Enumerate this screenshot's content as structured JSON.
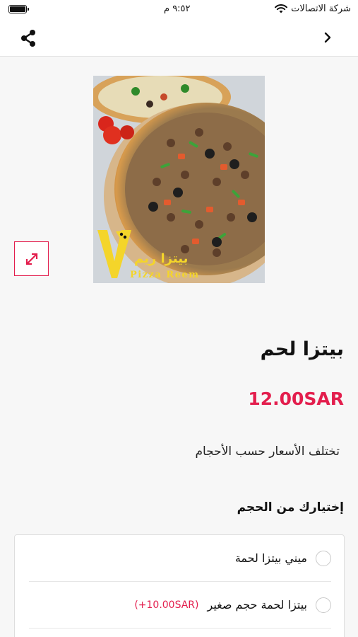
{
  "status_bar": {
    "carrier": "شركة الاتصالات",
    "time": "٩:٥٢ م"
  },
  "icons": {
    "share": "share-icon",
    "back": "chevron-right-icon",
    "expand": "expand-icon",
    "wifi": "wifi-icon",
    "battery": "battery-icon"
  },
  "product": {
    "image_logo_text_ar": "بيتزا ريم",
    "image_logo_text_en": "Pizza Reem",
    "name": "بيتزا لحم",
    "price": "12.00SAR",
    "price_note": "تختلف الأسعار حسب الأحجام"
  },
  "options": {
    "title": "إختيارك من الحجم",
    "items": [
      {
        "label": "ميني بيتزا لحمة",
        "extra": ""
      },
      {
        "label": "بيتزا لحمة حجم صغير",
        "extra": "(+10.00SAR)"
      }
    ]
  },
  "colors": {
    "accent": "#e31e4d",
    "logo_yellow": "#f4d52a",
    "background": "#f7f7f7"
  }
}
